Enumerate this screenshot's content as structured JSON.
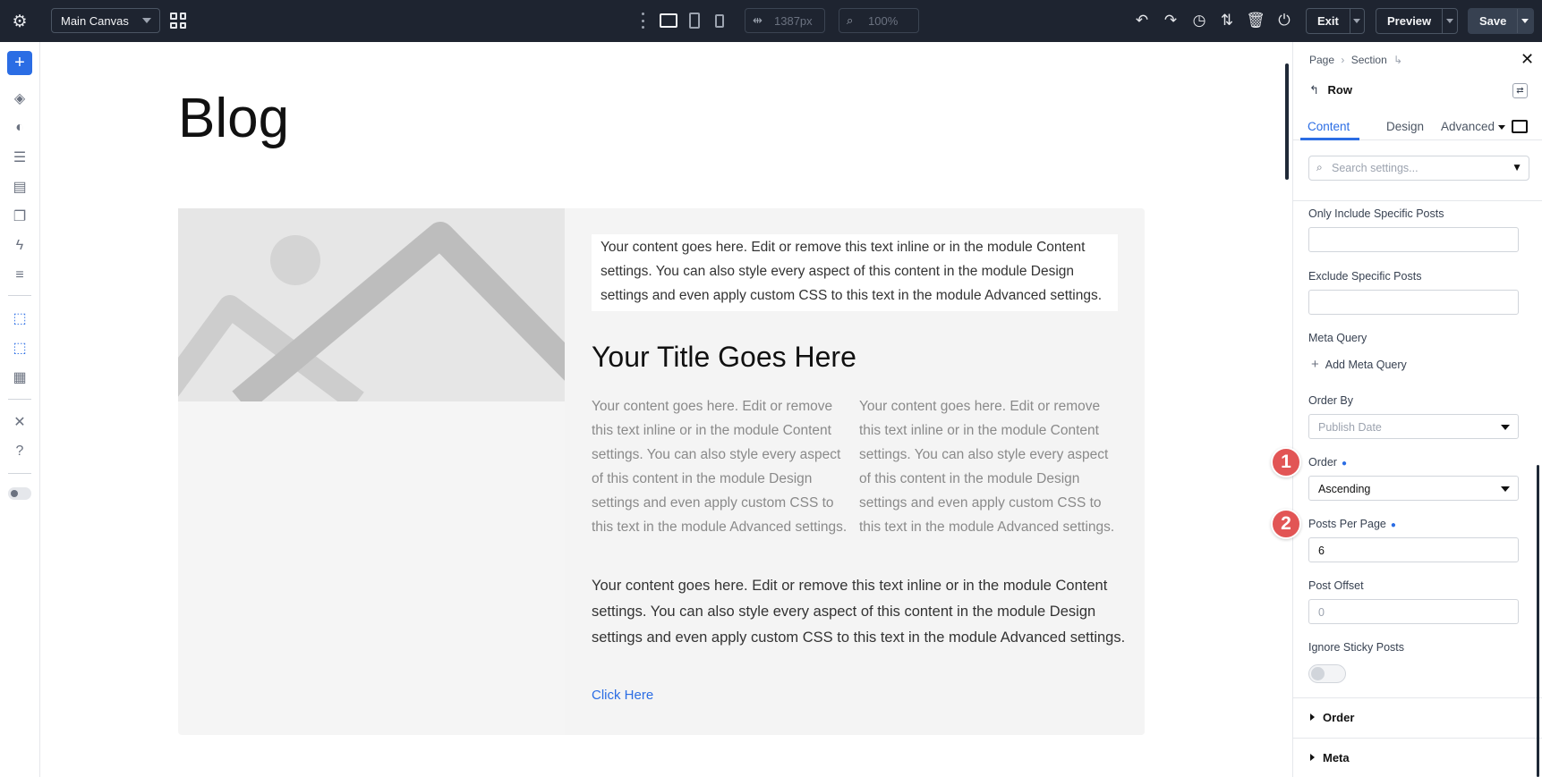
{
  "topbar": {
    "canvas_select": "Main Canvas",
    "width_value": "1387px",
    "zoom_value": "100%",
    "exit_label": "Exit",
    "preview_label": "Preview",
    "save_label": "Save"
  },
  "canvas": {
    "page_title": "Blog",
    "intro_text": "Your content goes here. Edit or remove this text inline or in the module Content settings. You can also style every aspect of this content in the module Design settings and even apply custom CSS to this text in the module Advanced settings.",
    "post_title": "Your Title Goes Here",
    "col_left_text": "Your content goes here. Edit or remove this text inline or in the module Content settings. You can also style every aspect of this content in the module Design settings and even apply custom CSS to this text in the module Advanced settings.",
    "col_right_text": "Your content goes here. Edit or remove this text inline or in the module Content settings. You can also style every aspect of this content in the module Design settings and even apply custom CSS to this text in the module Advanced settings.",
    "long_text": "Your content goes here. Edit or remove this text inline or in the module Content settings. You can also style every aspect of this content in the module Design settings and even apply custom CSS to this text in the module Advanced settings.",
    "link_text": "Click Here"
  },
  "panel": {
    "breadcrumb": [
      "Page",
      "Section"
    ],
    "title": "Row",
    "tabs": [
      "Content",
      "Design",
      "Advanced"
    ],
    "search_placeholder": "Search settings...",
    "fields": {
      "only_include_label": "Only Include Specific Posts",
      "exclude_label": "Exclude Specific Posts",
      "meta_query_label": "Meta Query",
      "add_meta_query": "Add Meta Query",
      "order_by_label": "Order By",
      "order_by_value": "Publish Date",
      "order_label": "Order",
      "order_value": "Ascending",
      "posts_per_page_label": "Posts Per Page",
      "posts_per_page_value": "6",
      "post_offset_label": "Post Offset",
      "post_offset_value": "0",
      "ignore_sticky_label": "Ignore Sticky Posts",
      "ignore_sticky_on": false
    },
    "accordions": [
      "Order",
      "Meta"
    ]
  },
  "annotations": [
    "1",
    "2"
  ],
  "colors": {
    "accent": "#2b6de4",
    "topbar_bg": "#1e2430",
    "badge": "#e25555"
  }
}
